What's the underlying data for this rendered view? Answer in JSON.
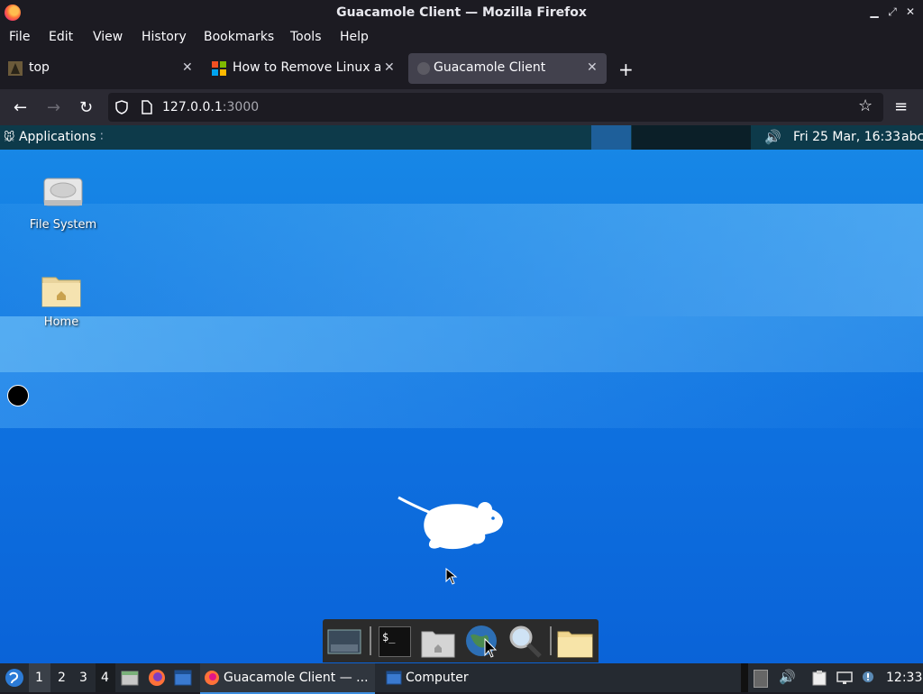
{
  "window": {
    "title": "Guacamole Client — Mozilla Firefox"
  },
  "menu": [
    "File",
    "Edit",
    "View",
    "History",
    "Bookmarks",
    "Tools",
    "Help"
  ],
  "tabs": [
    {
      "label": "top",
      "active": false
    },
    {
      "label": "How to Remove Linux an",
      "active": false
    },
    {
      "label": "Guacamole Client",
      "active": true
    }
  ],
  "new_tab": "+",
  "url": {
    "host": "127.0.0.1",
    "port": ":3000"
  },
  "xfce_panel": {
    "applications": "Applications",
    "clock": "Fri 25 Mar, 16:33",
    "user": "abc"
  },
  "desktop_icons": [
    {
      "label": "File System",
      "icon": "harddrive-icon"
    },
    {
      "label": "Home",
      "icon": "home-folder-icon"
    }
  ],
  "dock_items": [
    "show-desktop-icon",
    "terminal-icon",
    "home-folder-icon",
    "web-browser-icon",
    "search-icon",
    "folder-icon"
  ],
  "taskbar": {
    "workspaces": [
      "1",
      "2",
      "3",
      "4"
    ],
    "tasks": [
      {
        "label": "Guacamole Client — ...",
        "icon": "firefox-icon",
        "active": true
      },
      {
        "label": "Computer",
        "icon": "window-icon",
        "active": false
      }
    ],
    "clock": "12:33",
    "terminal_prompt": "$_"
  },
  "colors": {
    "firefox_bg": "#1c1b22",
    "desktop_blue": "#0f72e0",
    "taskbar_bg": "#252a31",
    "active_task_underline": "#3d8ee0"
  }
}
